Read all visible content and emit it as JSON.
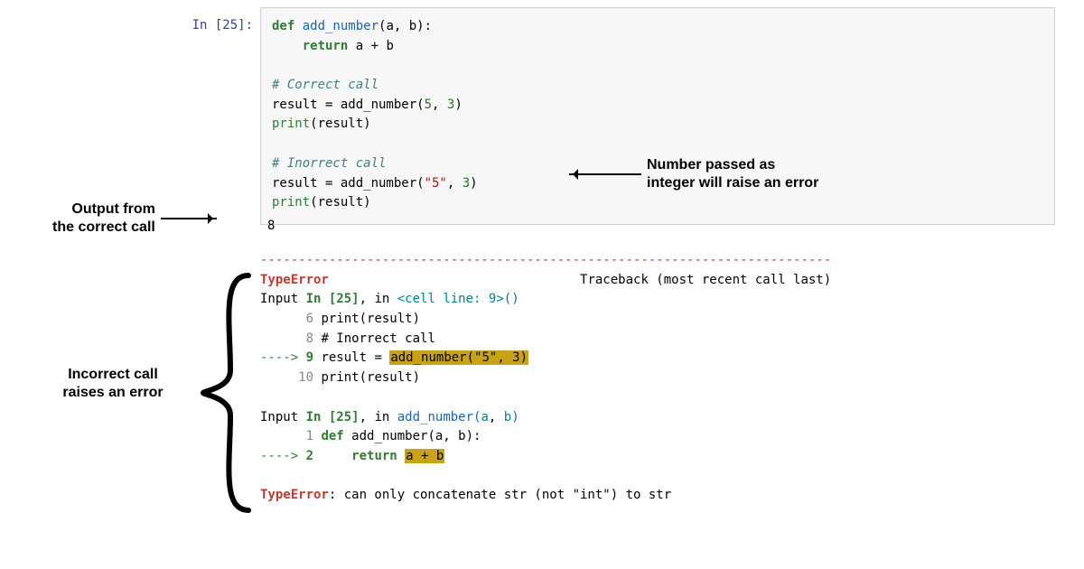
{
  "prompt": {
    "in_label": "In [",
    "num": "25",
    "close": "]:"
  },
  "code": {
    "l1_def": "def ",
    "l1_fn": "add_number",
    "l1_rest": "(a, b):",
    "l2_ret": "return",
    "l2_rest": " a + b",
    "l4_comment": "# Correct call",
    "l5": "result = add_number(",
    "l5_a": "5",
    "l5_m": ", ",
    "l5_b": "3",
    "l5_end": ")",
    "l6_print": "print",
    "l6_rest": "(result)",
    "l8_comment": "# Inorrect call",
    "l9": "result = add_number(",
    "l9_s": "\"5\"",
    "l9_m": ", ",
    "l9_b": "3",
    "l9_end": ")",
    "l10_print": "print",
    "l10_rest": "(result)"
  },
  "output_8": "8",
  "tb": {
    "dashes": "---------------------------------------------------------------------------",
    "err_name": "TypeError",
    "trace_label": "Traceback (most recent call last)",
    "r1_pre": "Input ",
    "r1_in": "In [25]",
    "r1_mid": ", in ",
    "r1_loc": "<cell line: 9>",
    "r1_end": "()",
    "r2_n": "6",
    "r2_t": " print(result)",
    "r3_n": "8",
    "r3_t": " # Inorrect call",
    "r4_arrow": "----> ",
    "r4_n": "9",
    "r4_pre": " result = ",
    "r4_hl": "add_number(\"5\", 3)",
    "r5_n": "10",
    "r5_t": " print(result)",
    "r6_pre": "Input ",
    "r6_in": "In [25]",
    "r6_mid": ", in ",
    "r6_fn": "add_number",
    "r6_args_open": "(",
    "r6_a": "a",
    "r6_comma": ", ",
    "r6_b": "b",
    "r6_args_close": ")",
    "r7_n": "1",
    "r7_def": " def",
    "r7_rest": " add_number(a, b):",
    "r8_arrow": "----> ",
    "r8_n": "2",
    "r8_ret": "     return ",
    "r8_hl": "a + b",
    "r9_err": "TypeError",
    "r9_msg": ": can only concatenate str (not \"int\") to str"
  },
  "ann": {
    "a1_l1": "Number passed as",
    "a1_l2": "integer will raise an error",
    "a2_l1": "Output from",
    "a2_l2": "the correct call",
    "a3_l1": "Incorrect call",
    "a3_l2": "raises an error"
  }
}
